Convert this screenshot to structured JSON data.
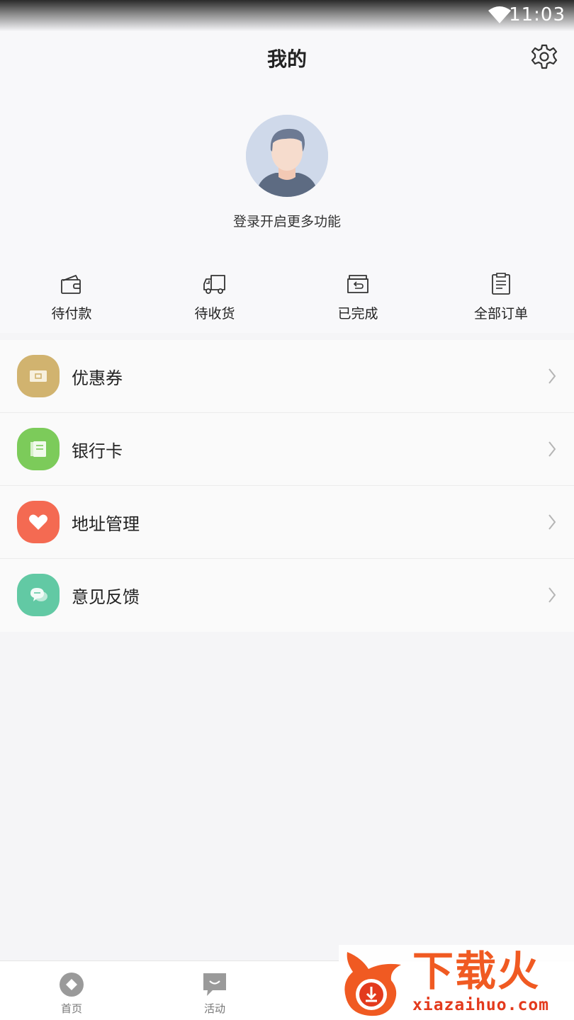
{
  "status_bar": {
    "time": "11:03"
  },
  "header": {
    "title": "我的"
  },
  "profile": {
    "login_prompt": "登录开启更多功能"
  },
  "orders": [
    {
      "label": "待付款",
      "icon": "wallet-icon"
    },
    {
      "label": "待收货",
      "icon": "truck-icon"
    },
    {
      "label": "已完成",
      "icon": "box-return-icon"
    },
    {
      "label": "全部订单",
      "icon": "clipboard-icon"
    }
  ],
  "menu": [
    {
      "label": "优惠券",
      "icon": "coupon-icon",
      "color": "#d1b36f"
    },
    {
      "label": "银行卡",
      "icon": "bank-card-icon",
      "color": "#7ccb5a"
    },
    {
      "label": "地址管理",
      "icon": "heart-icon",
      "color": "#f46a52"
    },
    {
      "label": "意见反馈",
      "icon": "chat-bubble-icon",
      "color": "#62c9a4"
    }
  ],
  "tabs": [
    {
      "label": "首页",
      "icon": "home-diamond-icon"
    },
    {
      "label": "活动",
      "icon": "smile-chat-icon"
    }
  ],
  "watermark": {
    "text_cn": "下载火",
    "text_en": "xiazaihuo.com"
  }
}
